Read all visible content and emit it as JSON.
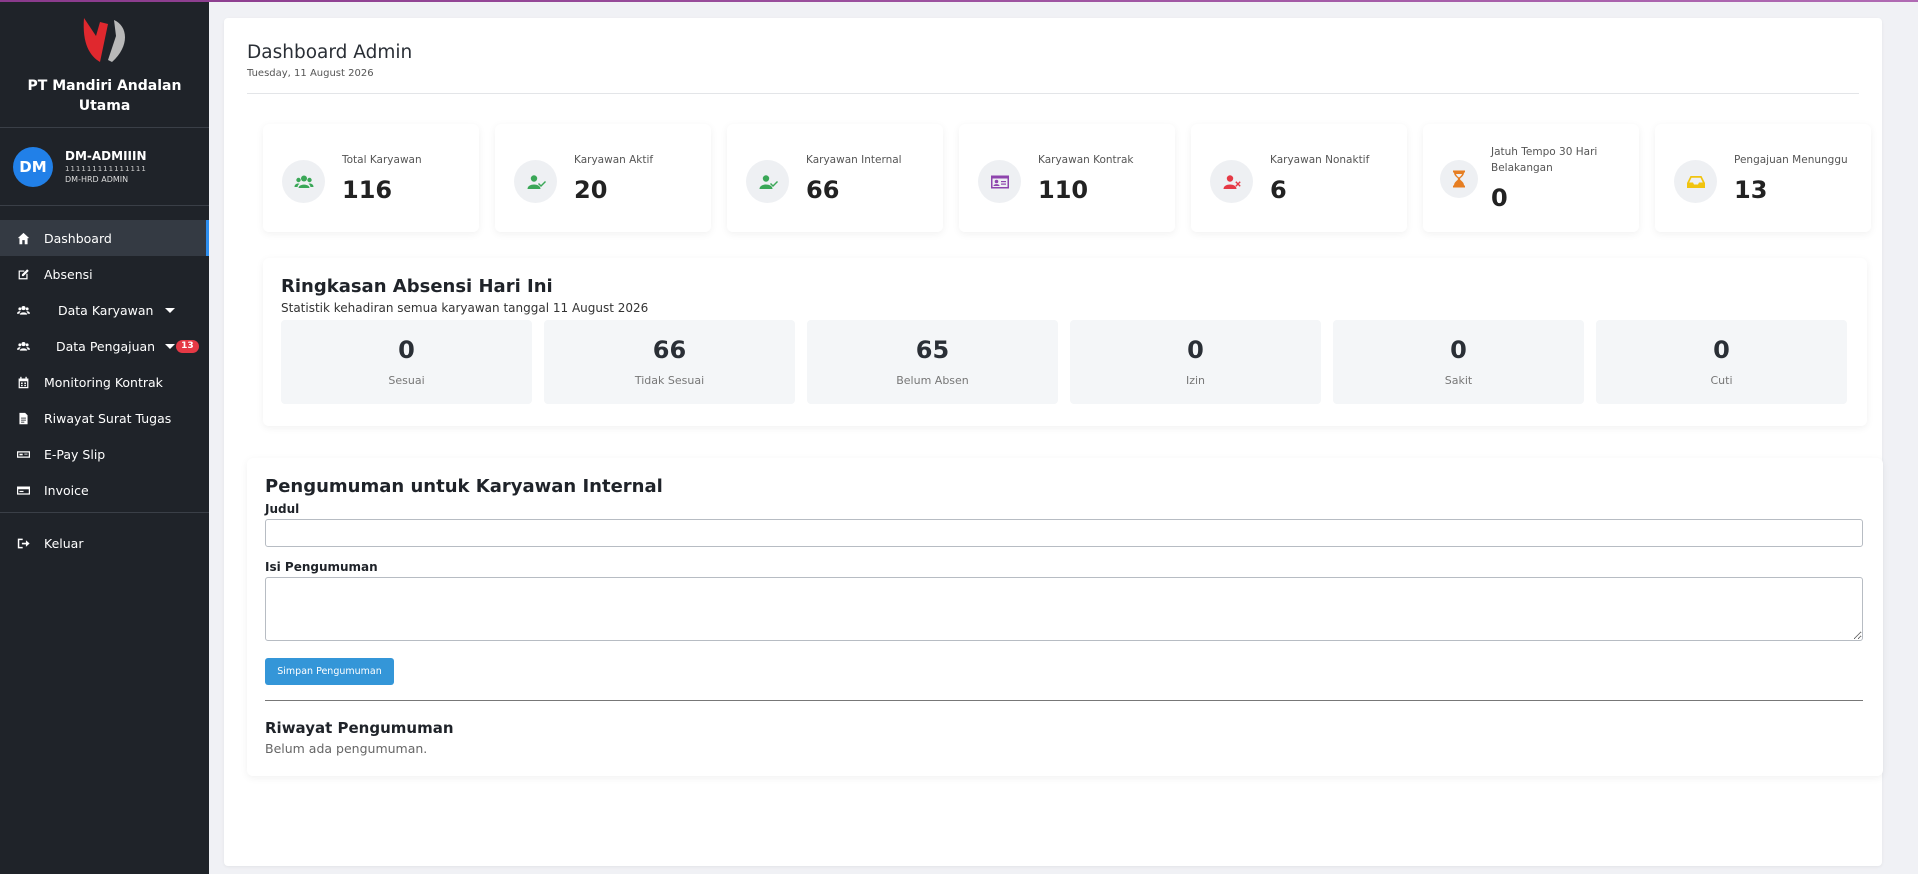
{
  "sidebar": {
    "company": "PT Mandiri Andalan Utama",
    "user": {
      "initials": "DM",
      "name": "DM-ADMIIIN",
      "id": "111111111111111",
      "role": "DM-HRD ADMIN"
    },
    "items": [
      {
        "label": "Dashboard",
        "icon": "home-icon",
        "active": true
      },
      {
        "label": "Absensi",
        "icon": "edit-icon"
      },
      {
        "label": "Data Karyawan",
        "icon": "users-icon",
        "dropdown": true
      },
      {
        "label": "Data Pengajuan",
        "icon": "users-icon",
        "dropdown": true,
        "badge": "13"
      },
      {
        "label": "Monitoring Kontrak",
        "icon": "calendar-icon"
      },
      {
        "label": "Riwayat Surat Tugas",
        "icon": "file-icon"
      },
      {
        "label": "E-Pay Slip",
        "icon": "money-icon"
      },
      {
        "label": "Invoice",
        "icon": "card-icon"
      }
    ],
    "logout": "Keluar"
  },
  "header": {
    "title": "Dashboard Admin",
    "date": "Tuesday, 11 August 2026"
  },
  "stats": [
    {
      "label": "Total Karyawan",
      "value": "116",
      "icon": "users-icon",
      "color": "#3aa757"
    },
    {
      "label": "Karyawan Aktif",
      "value": "20",
      "icon": "user-check-icon",
      "color": "#3aa757"
    },
    {
      "label": "Karyawan Internal",
      "value": "66",
      "icon": "user-check-icon",
      "color": "#3aa757"
    },
    {
      "label": "Karyawan Kontrak",
      "value": "110",
      "icon": "id-card-icon",
      "color": "#8e44ad"
    },
    {
      "label": "Karyawan Nonaktif",
      "value": "6",
      "icon": "user-x-icon",
      "color": "#e53945"
    },
    {
      "label": "Jatuh Tempo 30 Hari Belakangan",
      "value": "0",
      "icon": "hourglass-icon",
      "color": "#e67e22"
    },
    {
      "label": "Pengajuan Menunggu",
      "value": "13",
      "icon": "inbox-icon",
      "color": "#f1c40f"
    }
  ],
  "absensi": {
    "title": "Ringkasan Absensi Hari Ini",
    "subtitle": "Statistik kehadiran semua karyawan tanggal 11 August 2026",
    "items": [
      {
        "value": "0",
        "label": "Sesuai"
      },
      {
        "value": "66",
        "label": "Tidak Sesuai"
      },
      {
        "value": "65",
        "label": "Belum Absen"
      },
      {
        "value": "0",
        "label": "Izin"
      },
      {
        "value": "0",
        "label": "Sakit"
      },
      {
        "value": "0",
        "label": "Cuti"
      }
    ]
  },
  "announcement": {
    "title": "Pengumuman untuk Karyawan Internal",
    "judul_label": "Judul",
    "judul_value": "",
    "isi_label": "Isi Pengumuman",
    "isi_value": "",
    "save_label": "Simpan Pengumuman",
    "history_title": "Riwayat Pengumuman",
    "history_empty": "Belum ada pengumuman."
  }
}
